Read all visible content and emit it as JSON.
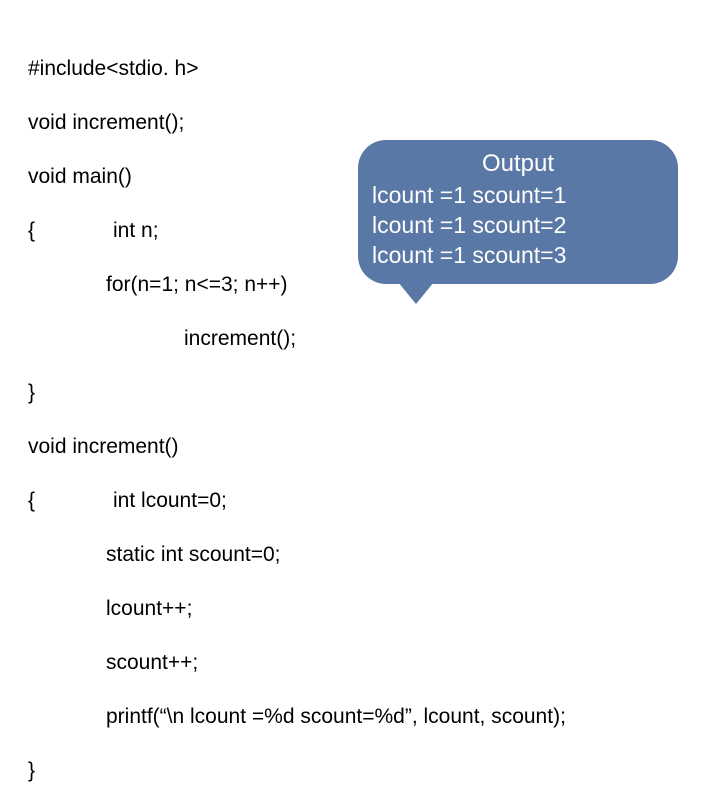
{
  "code": {
    "l1": "#include<stdio. h>",
    "l2": "void increment();",
    "l3": "void main()",
    "l4": "{",
    "l4b": "int n;",
    "l5": "for(n=1; n<=3; n++)",
    "l6": "increment();",
    "l7": "}",
    "l8": "void increment()",
    "l9": "{",
    "l9b": "int lcount=0;",
    "l10": "static int scount=0;",
    "l11": "lcount++;",
    "l12": "scount++;",
    "l13": "printf(“\\n lcount =%d scount=%d”, lcount, scount);",
    "l14": "}"
  },
  "output": {
    "title": "Output",
    "rows": [
      "lcount =1  scount=1",
      "lcount =1  scount=2",
      "lcount =1  scount=3"
    ]
  }
}
